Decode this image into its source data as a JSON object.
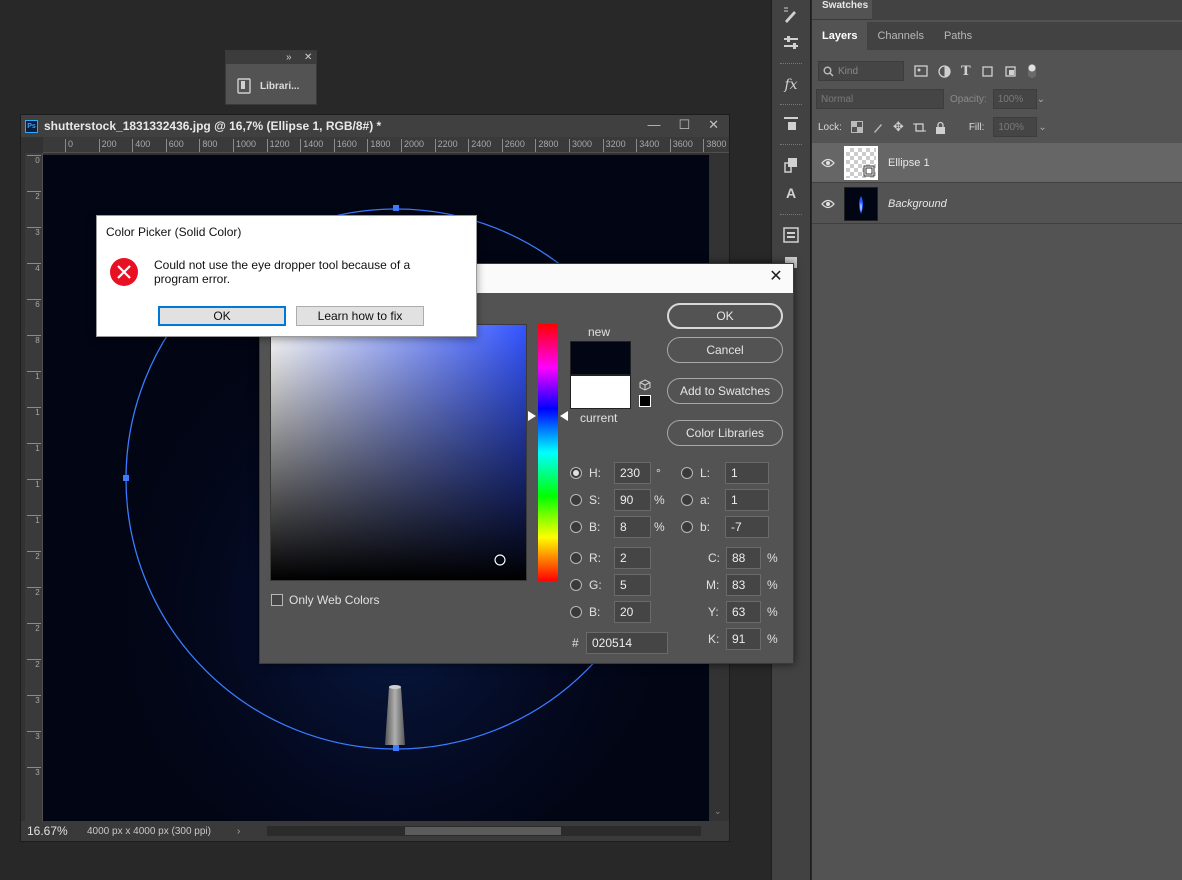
{
  "libraries_panel": {
    "collapse_icon": "double-chevron-right",
    "label": "Librari..."
  },
  "document": {
    "title": "shutterstock_1831332436.jpg @ 16,7% (Ellipse 1, RGB/8#) *",
    "ruler_top": [
      "0",
      "200",
      "400",
      "600",
      "800",
      "1000",
      "1200",
      "1400",
      "1600",
      "1800",
      "2000",
      "2200",
      "2400",
      "2600",
      "2800",
      "3000",
      "3200",
      "3400",
      "3600",
      "3800"
    ],
    "ruler_left": [
      "0",
      "2",
      "3",
      "4",
      "6",
      "8",
      "1",
      "1",
      "1",
      "1",
      "1",
      "2",
      "2",
      "2",
      "2",
      "3",
      "3",
      "3"
    ],
    "zoom": "16.67%",
    "doc_info": "4000 px x 4000 px (300 ppi)",
    "canvas_color": "#020514",
    "ellipse_stroke": "#3a7bff"
  },
  "right_panel": {
    "swatches_tab": "Swatches",
    "tabs": [
      "Layers",
      "Channels",
      "Paths"
    ],
    "filter_placeholder": "Kind",
    "blend_mode": "Normal",
    "opacity_label": "Opacity:",
    "opacity_value": "100%",
    "lock_label": "Lock:",
    "fill_label": "Fill:",
    "fill_value": "100%",
    "layers": [
      {
        "name": "Ellipse 1",
        "selected": true
      },
      {
        "name": "Background",
        "selected": false
      }
    ]
  },
  "color_picker": {
    "new_label": "new",
    "current_label": "current",
    "new_color": "#020514",
    "current_color": "#ffffff",
    "buttons": {
      "ok": "OK",
      "cancel": "Cancel",
      "add_swatches": "Add to Swatches",
      "libraries": "Color Libraries"
    },
    "only_web_colors": "Only Web Colors",
    "hsb": {
      "h_label": "H:",
      "h": "230",
      "h_unit": "°",
      "s_label": "S:",
      "s": "90",
      "s_unit": "%",
      "b_label": "B:",
      "b": "8",
      "b_unit": "%"
    },
    "rgb": {
      "r_label": "R:",
      "r": "2",
      "g_label": "G:",
      "g": "5",
      "b_label": "B:",
      "b": "20"
    },
    "lab": {
      "l_label": "L:",
      "l": "1",
      "a_label": "a:",
      "a": "1",
      "b_label": "b:",
      "b": "-7"
    },
    "cmyk": {
      "c_label": "C:",
      "c": "88",
      "m_label": "M:",
      "m": "83",
      "y_label": "Y:",
      "y": "63",
      "k_label": "K:",
      "k": "91",
      "unit": "%"
    },
    "hex_label": "#",
    "hex": "020514",
    "field_hue_color": "#3355ff",
    "close_glyph": "✕"
  },
  "error_dialog": {
    "title": "Color Picker (Solid Color)",
    "message": "Could not use the eye dropper tool because of a program error.",
    "ok": "OK",
    "learn": "Learn how to fix"
  }
}
